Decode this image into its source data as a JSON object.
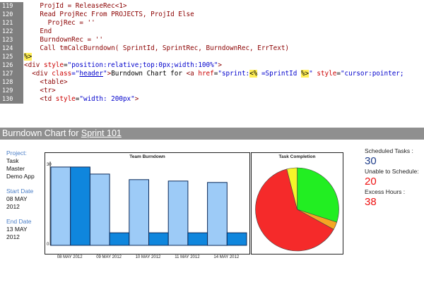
{
  "code_editor": {
    "lines": [
      {
        "num": "119",
        "tokens": [
          {
            "t": "    ProjId = ReleaseRec<1>",
            "c": "c-asp"
          }
        ]
      },
      {
        "num": "120",
        "tokens": [
          {
            "t": "    Read ProjRec From PROJECTS, ProjId Else",
            "c": "c-asp"
          }
        ]
      },
      {
        "num": "121",
        "tokens": [
          {
            "t": "      ProjRec = ''",
            "c": "c-asp"
          }
        ]
      },
      {
        "num": "122",
        "tokens": [
          {
            "t": "    End",
            "c": "c-asp"
          }
        ]
      },
      {
        "num": "123",
        "tokens": [
          {
            "t": "    BurndownRec = ''",
            "c": "c-asp"
          }
        ]
      },
      {
        "num": "124",
        "tokens": [
          {
            "t": "    Call tmCalcBurndown( SprintId, SprintRec, BurndownRec, ErrText)",
            "c": "c-asp"
          }
        ]
      },
      {
        "num": "125",
        "tokens": [
          {
            "t": "%>",
            "c": "c-delim"
          }
        ]
      },
      {
        "num": "126",
        "tokens": [
          {
            "t": "<div ",
            "c": "c-tag"
          },
          {
            "t": "style",
            "c": "c-attr"
          },
          {
            "t": "=",
            "c": "c-plain"
          },
          {
            "t": "\"position:relative;top:0px;width:100%\"",
            "c": "c-val"
          },
          {
            "t": ">",
            "c": "c-tag"
          }
        ]
      },
      {
        "num": "127",
        "tokens": [
          {
            "t": "  <div ",
            "c": "c-tag"
          },
          {
            "t": "class",
            "c": "c-attr"
          },
          {
            "t": "=\"",
            "c": "c-val"
          },
          {
            "t": "header",
            "c": "c-link"
          },
          {
            "t": "\"",
            "c": "c-val"
          },
          {
            "t": ">",
            "c": "c-tag"
          },
          {
            "t": "Burndown Chart for ",
            "c": "c-plain"
          },
          {
            "t": "<a ",
            "c": "c-tag"
          },
          {
            "t": "href",
            "c": "c-attr"
          },
          {
            "t": "=",
            "c": "c-plain"
          },
          {
            "t": "\"sprint:",
            "c": "c-val"
          },
          {
            "t": "<%",
            "c": "c-delim"
          },
          {
            "t": " =SprintId ",
            "c": "c-val"
          },
          {
            "t": "%>",
            "c": "c-delim"
          },
          {
            "t": "\" ",
            "c": "c-val"
          },
          {
            "t": "style",
            "c": "c-attr"
          },
          {
            "t": "=",
            "c": "c-plain"
          },
          {
            "t": "\"cursor:pointer;",
            "c": "c-val"
          }
        ]
      },
      {
        "num": "128",
        "tokens": [
          {
            "t": "    <table>",
            "c": "c-tag"
          }
        ]
      },
      {
        "num": "129",
        "tokens": [
          {
            "t": "    <tr>",
            "c": "c-tag"
          }
        ]
      },
      {
        "num": "130",
        "tokens": [
          {
            "t": "    <td ",
            "c": "c-tag"
          },
          {
            "t": "style",
            "c": "c-attr"
          },
          {
            "t": "=",
            "c": "c-plain"
          },
          {
            "t": "\"width: 200px\"",
            "c": "c-val"
          },
          {
            "t": ">",
            "c": "c-tag"
          }
        ]
      }
    ]
  },
  "report": {
    "header_prefix": "Burndown Chart for ",
    "sprint_link": "Sprint 101"
  },
  "info": {
    "project_label": "Project:",
    "project_value_lines": [
      "Task",
      "Master",
      "Demo App"
    ],
    "start_label": "Start Date",
    "start_value_lines": [
      "08 MAY",
      "2012"
    ],
    "end_label": "End Date",
    "end_value_lines": [
      "13 MAY",
      "2012"
    ]
  },
  "stats": {
    "scheduled_label": "Scheduled Tasks :",
    "scheduled_value": "30",
    "unable_label": "Unable to Schedule:",
    "unable_value": "20",
    "excess_label": "Excess Hours :",
    "excess_value": "38",
    "colors": {
      "scheduled": "#1f3d8a",
      "unable": "#ee1111",
      "excess": "#ee1111"
    }
  },
  "chart_data": [
    {
      "type": "bar",
      "title": "Team Burndown",
      "ylim": [
        0,
        30
      ],
      "y_tick_labels": [
        "30",
        "0"
      ],
      "categories": [
        "08 MAY 2012",
        "",
        "09 MAY 2012",
        "",
        "10 MAY 2012",
        "",
        "11 MAY 2012",
        "",
        "14 MAY 2012",
        ""
      ],
      "x_tick_labels": [
        "08 MAY 2012",
        "09 MAY 2012",
        "10 MAY 2012",
        "11 MAY 2012",
        "14 MAY 2012"
      ],
      "values": [
        28,
        28,
        25.5,
        4.5,
        23.5,
        4.5,
        23,
        4.5,
        22.5,
        4.5
      ],
      "bar_colors": [
        "#9dcbf7",
        "#0f86dd",
        "#9dcbf7",
        "#0f86dd",
        "#9dcbf7",
        "#0f86dd",
        "#9dcbf7",
        "#0f86dd",
        "#9dcbf7",
        "#0f86dd"
      ],
      "grid": false
    },
    {
      "type": "pie",
      "title": "Task Completion",
      "slices": [
        {
          "value": 30,
          "color": "#22ee22"
        },
        {
          "value": 3,
          "color": "#f5a623"
        },
        {
          "value": 63,
          "color": "#f52a2a"
        },
        {
          "value": 4,
          "color": "#f5f52a"
        }
      ]
    }
  ]
}
